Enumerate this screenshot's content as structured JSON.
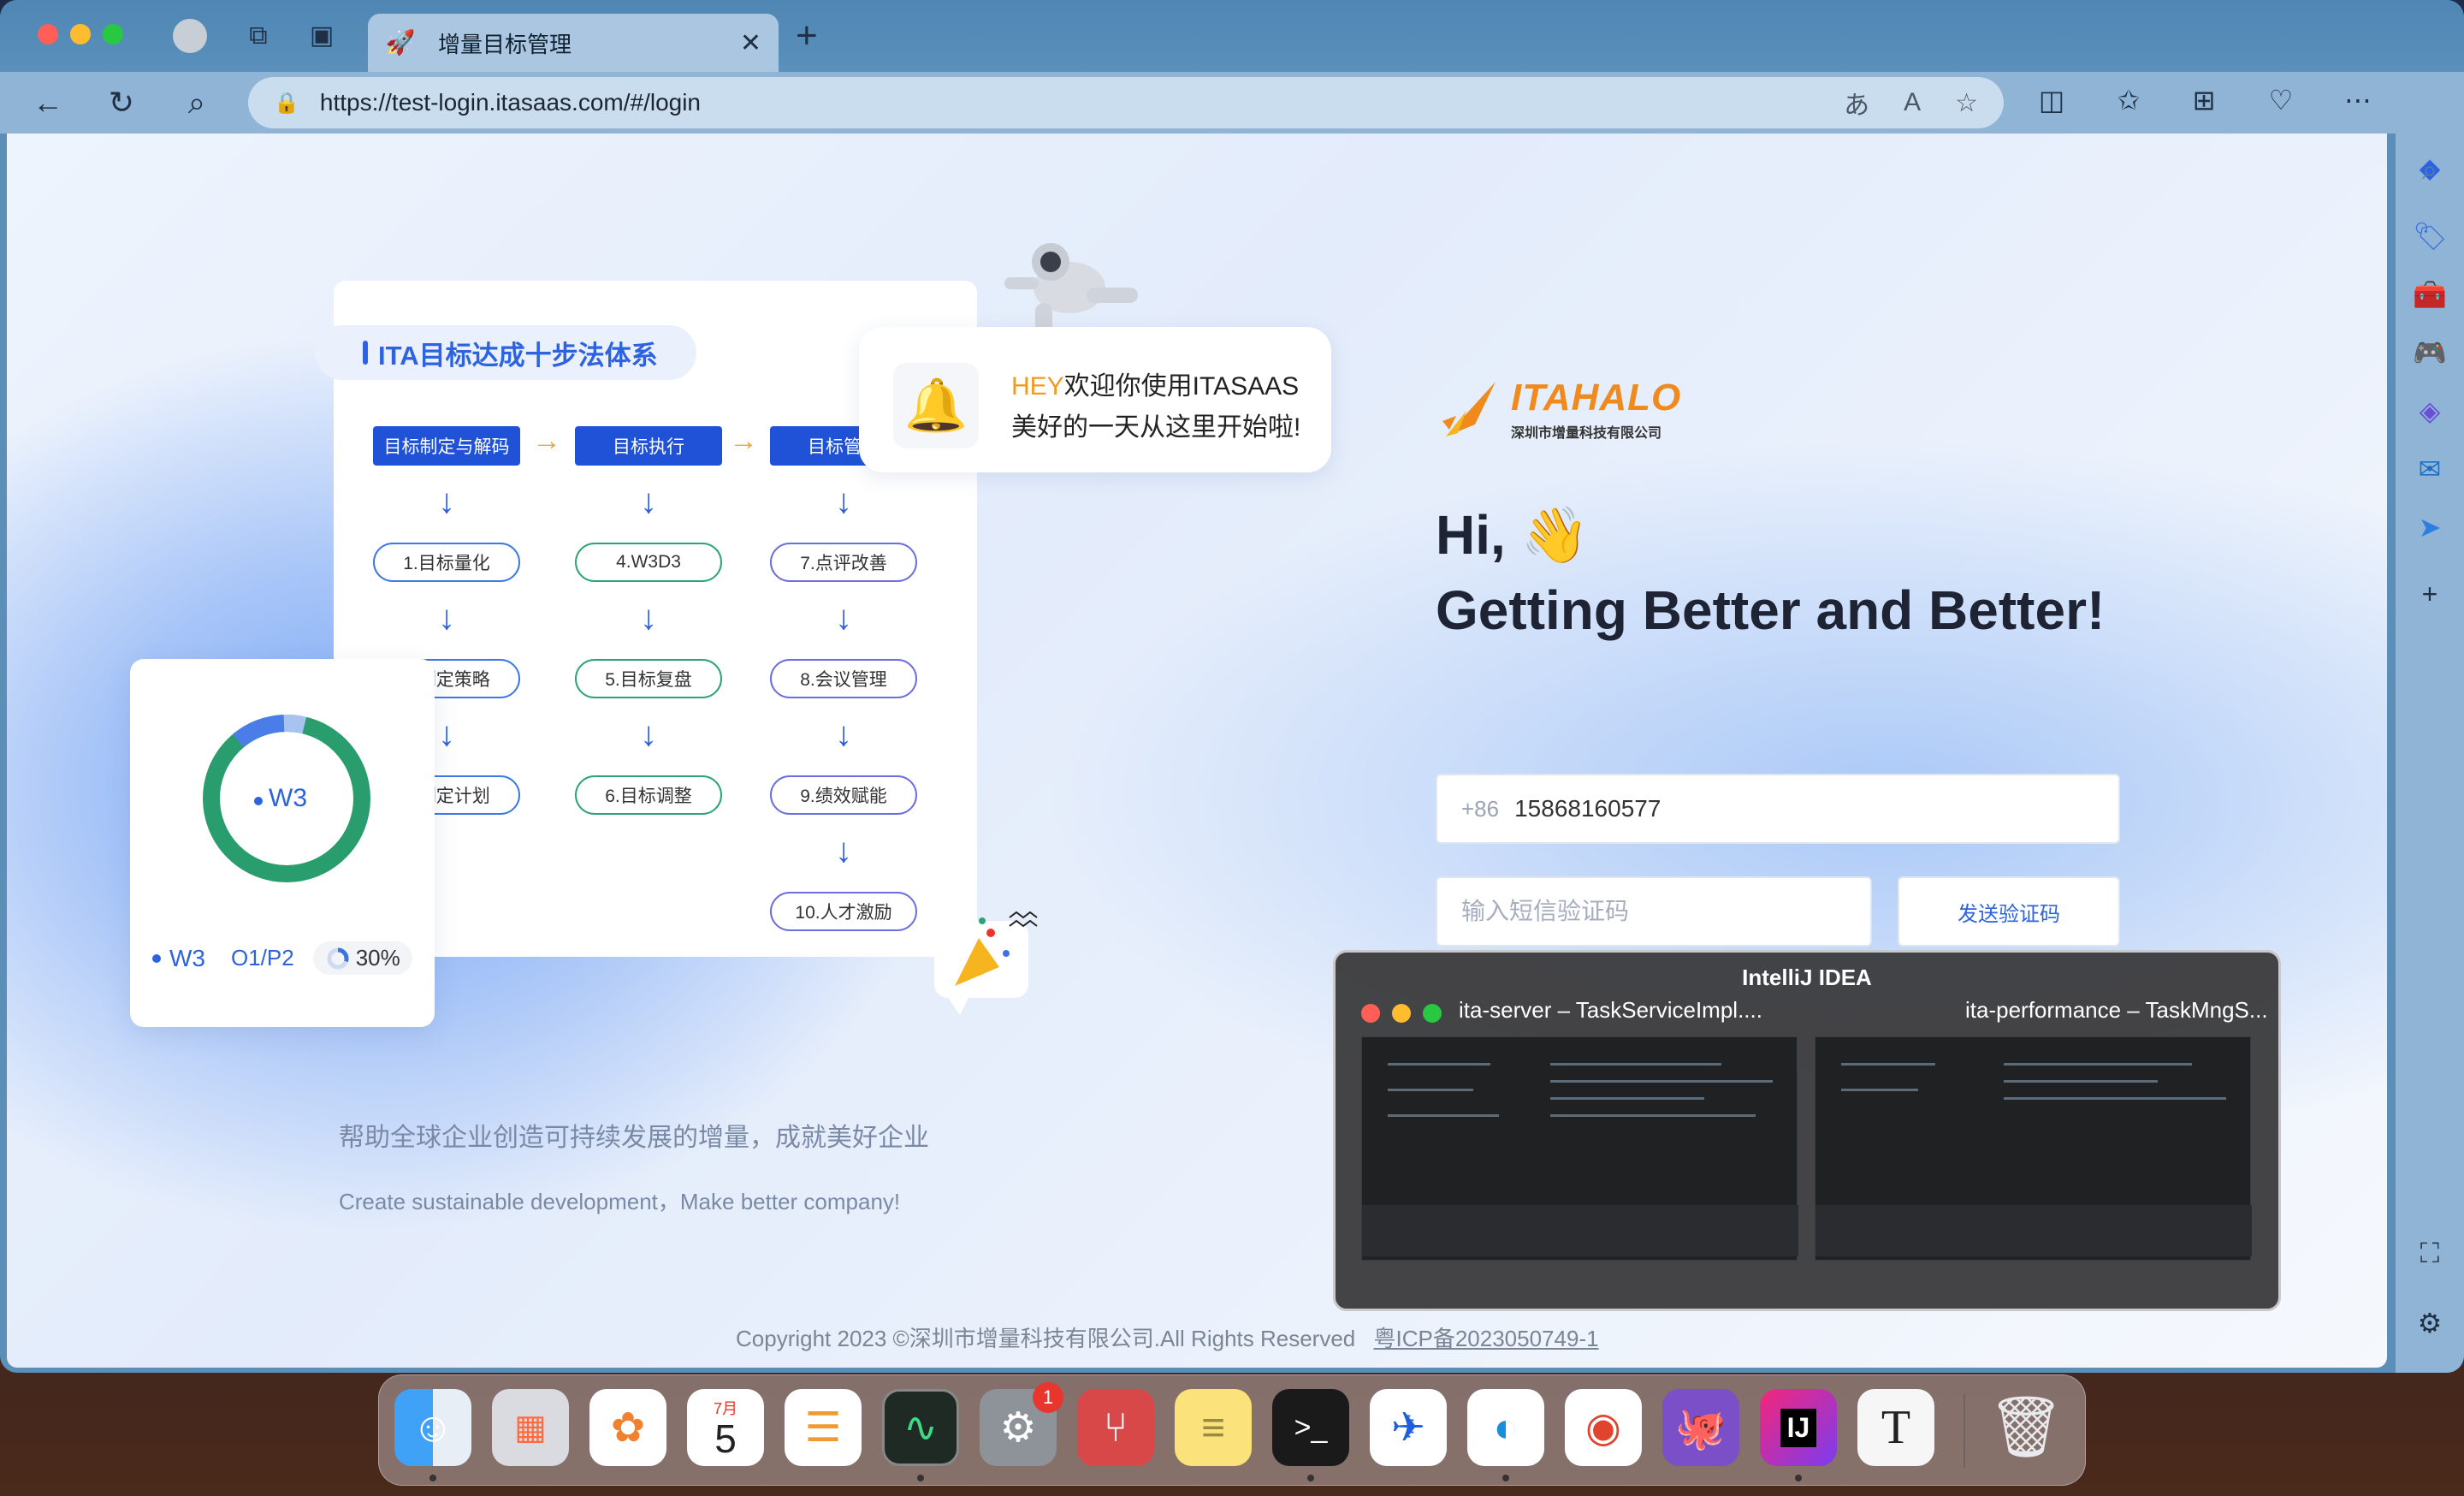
{
  "browser": {
    "tab_title": "增量目标管理",
    "url": "https://test-login.itasaas.com/#/login"
  },
  "page": {
    "system_title": "ITA目标达成十步法体系",
    "column_headers": [
      "目标制定与解码",
      "目标执行",
      "目标管理"
    ],
    "col1_steps": [
      "1.目标量化",
      "2.制定策略",
      "3.制定计划"
    ],
    "col2_steps": [
      "4.W3D3",
      "5.目标复盘",
      "6.目标调整"
    ],
    "col3_steps": [
      "7.点评改善",
      "8.会议管理",
      "9.绩效赋能",
      "10.人才激励"
    ],
    "notify_hey": "HEY",
    "notify_line1": "欢迎你使用ITASAAS",
    "notify_line2": "美好的一天从这里开始啦!",
    "w3_donut_label": "W3",
    "w3_row_label": "W3",
    "w3_row_code": "O1/P2",
    "w3_percent": "30%",
    "slogan_cn": "帮助全球企业创造可持续发展的增量，成就美好企业",
    "slogan_en": "Create sustainable development，Make better company!",
    "logo_name": "ITAHALO",
    "logo_sub": "深圳市增量科技有限公司",
    "greeting_hi": "Hi, 👋",
    "headline": "Getting Better and Better!",
    "phone_country_code": "+86",
    "phone_value": "15868160577",
    "code_placeholder": "输入短信验证码",
    "send_code_label": "发送验证码",
    "footer_copyright": "Copyright 2023 ©深圳市增量科技有限公司.All Rights Reserved",
    "footer_icp": "粤ICP备2023050749-1"
  },
  "app_switcher": {
    "app_name": "IntelliJ IDEA",
    "window1_title": "ita-server – TaskServiceImpl....",
    "window2_title": "ita-performance – TaskMngS..."
  },
  "dock": {
    "calendar_month": "7月",
    "calendar_day": "5",
    "settings_badge": "1",
    "intellij_label": "IJ",
    "typora_label": "T"
  },
  "colors": {
    "brand_blue": "#2d63e0",
    "brand_orange": "#f08a1c",
    "donut_green": "#2a9d6e"
  }
}
